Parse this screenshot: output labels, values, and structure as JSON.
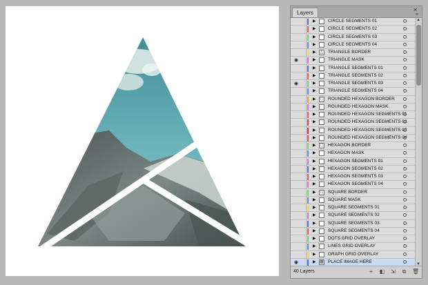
{
  "panel": {
    "tab_label": "Layers",
    "close_symbol": "✕",
    "menu_symbol": "≡"
  },
  "layers": [
    {
      "name": "CIRCLE SEGMENTS 01",
      "color": "#4f6bd6",
      "thumb": "",
      "visible": false,
      "selected": false
    },
    {
      "name": "CIRCLE SEGMENTS 02",
      "color": "#e25b5b",
      "thumb": "",
      "visible": false,
      "selected": false
    },
    {
      "name": "CIRCLE SEGMENTS 03",
      "color": "#6bd86b",
      "thumb": "",
      "visible": false,
      "selected": false
    },
    {
      "name": "CIRCLE SEGMENTS 04",
      "color": "#5a8fe0",
      "thumb": "",
      "visible": false,
      "selected": false
    },
    {
      "name": "TRIANGLE BORDER",
      "color": "#f0d84a",
      "thumb": "△",
      "visible": false,
      "selected": false
    },
    {
      "name": "TRIANGLE MASK",
      "color": "#d970d9",
      "thumb": "",
      "visible": true,
      "selected": false
    },
    {
      "name": "TRIANGLE SEGMENTS 01",
      "color": "#4f6bd6",
      "thumb": "",
      "visible": false,
      "selected": false
    },
    {
      "name": "TRIANGLE SEGMENTS 02",
      "color": "#e25b5b",
      "thumb": "",
      "visible": false,
      "selected": false
    },
    {
      "name": "TRIANGLE SEGMENTS 03",
      "color": "#6bd86b",
      "thumb": "",
      "visible": true,
      "selected": false
    },
    {
      "name": "TRIANGLE SEGMENTS 04",
      "color": "#5a8fe0",
      "thumb": "",
      "visible": false,
      "selected": false
    },
    {
      "name": "ROUNDED HEXAGON BORDER",
      "color": "#f0a040",
      "thumb": "⬡",
      "visible": false,
      "selected": false
    },
    {
      "name": "ROUNDED HEXAGON MASK",
      "color": "#d970d9",
      "thumb": "",
      "visible": false,
      "selected": false
    },
    {
      "name": "ROUNDED HEXAGON SEGMENTS 01",
      "color": "#e25b5b",
      "thumb": "",
      "visible": false,
      "selected": false
    },
    {
      "name": "ROUNDED HEXAGON SEGMENTS 02",
      "color": "#d84040",
      "thumb": "",
      "visible": false,
      "selected": false
    },
    {
      "name": "ROUNDED HEXAGON SEGMENTS 03",
      "color": "#c83030",
      "thumb": "",
      "visible": false,
      "selected": false
    },
    {
      "name": "ROUNDED HEXAGON SEGMENTS 04",
      "color": "#e05050",
      "thumb": "",
      "visible": false,
      "selected": false
    },
    {
      "name": "HEXAGON BORDER",
      "color": "#6bd86b",
      "thumb": "⬡",
      "visible": false,
      "selected": false
    },
    {
      "name": "HEXAGON MASK",
      "color": "#5a8fe0",
      "thumb": "",
      "visible": false,
      "selected": false
    },
    {
      "name": "HEXAGON SEGMENTS 01",
      "color": "#d970d9",
      "thumb": "",
      "visible": false,
      "selected": false
    },
    {
      "name": "HEXAGON SEGMENTS 02",
      "color": "#4f6bd6",
      "thumb": "",
      "visible": false,
      "selected": false
    },
    {
      "name": "HEXAGON SEGMENTS 03",
      "color": "#e25b5b",
      "thumb": "",
      "visible": false,
      "selected": false
    },
    {
      "name": "HEXAGON SEGMENTS 04",
      "color": "#d970d9",
      "thumb": "",
      "visible": false,
      "selected": false
    },
    {
      "name": "SQUARE BORDER",
      "color": "#6bd86b",
      "thumb": "□",
      "visible": false,
      "selected": false
    },
    {
      "name": "SQUARE MASK",
      "color": "#5a8fe0",
      "thumb": "",
      "visible": false,
      "selected": false
    },
    {
      "name": "SQUARE SEGMENTS 01",
      "color": "#f0d84a",
      "thumb": "",
      "visible": false,
      "selected": false
    },
    {
      "name": "SQUARE SEGMENTS 02",
      "color": "#d970d9",
      "thumb": "",
      "visible": false,
      "selected": false
    },
    {
      "name": "SQUARE SEGMENTS 03",
      "color": "#4f6bd6",
      "thumb": "",
      "visible": false,
      "selected": false
    },
    {
      "name": "SQUARE SEGMENTS 04",
      "color": "#e25b5b",
      "thumb": "",
      "visible": false,
      "selected": false
    },
    {
      "name": "DOTS GRID OVERLAY",
      "color": "#6bd86b",
      "thumb": "",
      "visible": false,
      "selected": false
    },
    {
      "name": "LINES GRID OVERLAY",
      "color": "#5a8fe0",
      "thumb": "",
      "visible": false,
      "selected": false
    },
    {
      "name": "GRAPH GRID OVERLAY",
      "color": "#f0d84a",
      "thumb": "",
      "visible": false,
      "selected": false
    },
    {
      "name": "PLACE IMAGE HERE",
      "color": "#4f6bd6",
      "thumb": "▦",
      "visible": true,
      "selected": true
    }
  ],
  "footer": {
    "layer_count": "40 Layers"
  }
}
